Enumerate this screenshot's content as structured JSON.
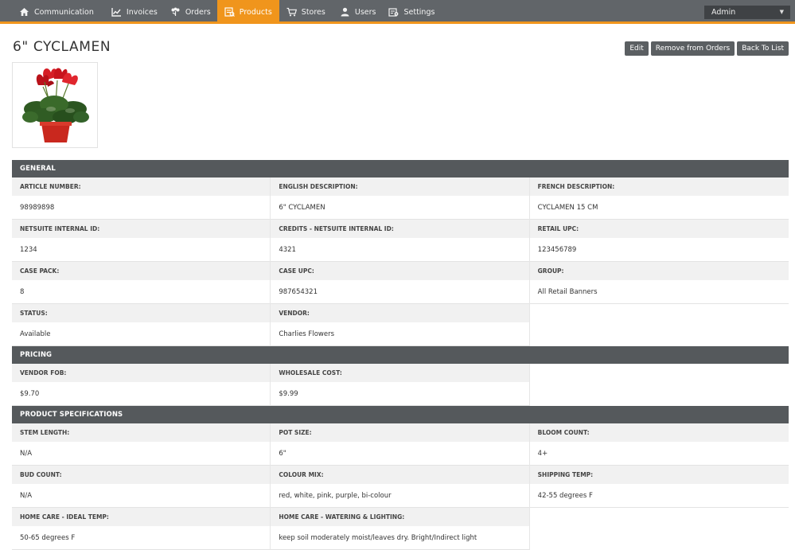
{
  "nav": {
    "items": [
      {
        "label": "Communication",
        "icon": "home-icon"
      },
      {
        "label": "Invoices",
        "icon": "chart-icon"
      },
      {
        "label": "Orders",
        "icon": "flower-icon"
      },
      {
        "label": "Products",
        "icon": "products-icon"
      },
      {
        "label": "Stores",
        "icon": "cart-icon"
      },
      {
        "label": "Users",
        "icon": "user-icon"
      },
      {
        "label": "Settings",
        "icon": "settings-icon"
      }
    ],
    "active": "Products",
    "user_select": "Admin"
  },
  "colors": {
    "nav_bg": "#616569",
    "accent": "#f0951c",
    "section_bg": "#55595c",
    "button_bg": "#5b5f62"
  },
  "page": {
    "title": "6\" CYCLAMEN",
    "buttons": {
      "edit": "Edit",
      "remove": "Remove from Orders",
      "back": "Back To List"
    }
  },
  "sections": {
    "general": {
      "title": "GENERAL",
      "fields": [
        {
          "label": "ARTICLE NUMBER:",
          "value": "98989898"
        },
        {
          "label": "ENGLISH DESCRIPTION:",
          "value": "6\" CYCLAMEN"
        },
        {
          "label": "FRENCH DESCRIPTION:",
          "value": "CYCLAMEN 15 CM"
        },
        {
          "label": "NETSUITE INTERNAL ID:",
          "value": "1234"
        },
        {
          "label": "CREDITS - NETSUITE INTERNAL ID:",
          "value": "4321"
        },
        {
          "label": "RETAIL UPC:",
          "value": "123456789"
        },
        {
          "label": "CASE PACK:",
          "value": "8"
        },
        {
          "label": "CASE UPC:",
          "value": "987654321"
        },
        {
          "label": "GROUP:",
          "value": "All Retail Banners"
        },
        {
          "label": "STATUS:",
          "value": "Available"
        },
        {
          "label": "VENDOR:",
          "value": "Charlies Flowers"
        }
      ]
    },
    "pricing": {
      "title": "PRICING",
      "fields": [
        {
          "label": "VENDOR FOB:",
          "value": "$9.70"
        },
        {
          "label": "WHOLESALE COST:",
          "value": "$9.99"
        }
      ]
    },
    "specs": {
      "title": "PRODUCT SPECIFICATIONS",
      "fields": [
        {
          "label": "STEM LENGTH:",
          "value": "N/A"
        },
        {
          "label": "POT SIZE:",
          "value": "6\""
        },
        {
          "label": "BLOOM COUNT:",
          "value": "4+"
        },
        {
          "label": "BUD COUNT:",
          "value": "N/A"
        },
        {
          "label": "COLOUR MIX:",
          "value": "red, white, pink, purple, bi-colour"
        },
        {
          "label": "SHIPPING TEMP:",
          "value": "42-55 degrees F"
        },
        {
          "label": "HOME CARE - IDEAL TEMP:",
          "value": "50-65 degrees F"
        },
        {
          "label": "HOME CARE - WATERING & LIGHTING:",
          "value": "keep soil moderately moist/leaves dry. Bright/Indirect light"
        }
      ]
    }
  }
}
